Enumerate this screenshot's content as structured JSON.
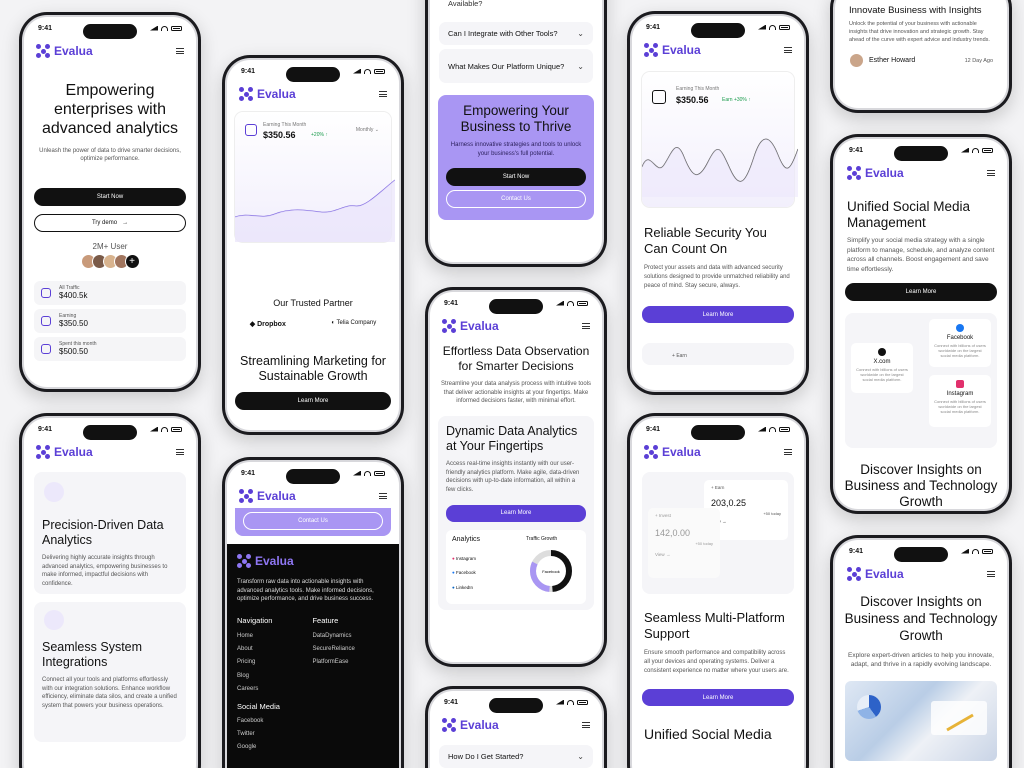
{
  "brand": {
    "name": "Evalua",
    "accent": "#5b3fd6",
    "status_time": "9:41"
  },
  "p1": {
    "headline": "Empowering enterprises with advanced analytics",
    "sub": "Unleash the power of data to drive smarter decisions, optimize performance.",
    "start_btn": "Start Now",
    "demo_btn": "Try demo",
    "users_label": "2M+ User",
    "stats": [
      {
        "label": "All Traffic",
        "value": "$400.5k"
      },
      {
        "label": "Earning",
        "value": "$350.50"
      },
      {
        "label": "Spent this month",
        "value": "$500.50"
      }
    ]
  },
  "p2": {
    "earning_label": "Earning This Month",
    "earning_value": "$350.56",
    "earning_delta": "+20% ↑",
    "period": "Monthly",
    "partner_title": "Our Trusted Partner",
    "partners": [
      "Dropbox",
      "Telia Company"
    ],
    "headline": "Streamlining Marketing for Sustainable Growth",
    "learn_btn": "Learn More"
  },
  "p3": {
    "faq_top": "Available?",
    "faqs": [
      "Can I Integrate with Other Tools?",
      "What Makes Our Platform Unique?"
    ],
    "headline": "Empowering Your Business to Thrive",
    "sub": "Harness innovative strategies and tools to unlock your business's full potential.",
    "start_btn": "Start Now",
    "contact_btn": "Contact Us"
  },
  "p4": {
    "earning_label": "Earning This Month",
    "earning_value": "$350.56",
    "earning_delta": "Earn +30% ↑",
    "headline": "Reliable Security You Can Count On",
    "sub": "Protect your assets and data with advanced security solutions designed to provide unmatched reliability and peace of mind. Stay secure, always.",
    "learn_btn": "Learn More",
    "foot": "Earn"
  },
  "p5": {
    "top_title": "Innovate Business with Insights",
    "top_sub": "Unlock the potential of your business with actionable insights that drive innovation and strategic growth. Stay ahead of the curve with expert advice and industry trends.",
    "author": "Esther Howard",
    "ago": "12 Day Ago"
  },
  "p6": {
    "headline": "Unified Social Media Management",
    "sub": "Simplify your social media strategy with a single platform to manage, schedule, and analyze content across all channels. Boost engagement and save time effortlessly.",
    "learn_btn": "Learn More",
    "nodes": [
      {
        "name": "Facebook",
        "desc": "Connect with billions of users worldwide on the largest social media platform."
      },
      {
        "name": "X.com",
        "desc": "Connect with billions of users worldwide on the largest social media platform."
      },
      {
        "name": "Instagram",
        "desc": "Connect with billions of users worldwide on the largest social media platform."
      }
    ],
    "bottom": "Discover Insights on Business and Technology Growth"
  },
  "p7": {
    "headline": "Precision-Driven Data Analytics",
    "sub": "Delivering highly accurate insights through advanced analytics, empowering businesses to make informed, impactful decisions with confidence.",
    "headline2": "Seamless System Integrations",
    "sub2": "Connect all your tools and platforms effortlessly with our integration solutions. Enhance workflow efficiency, eliminate data silos, and create a unified system that powers your business operations."
  },
  "p8": {
    "contact_btn": "Contact Us",
    "about": "Transform raw data into actionable insights with advanced analytics tools. Make informed decisions, optimize performance, and drive business success.",
    "nav_title": "Navigation",
    "nav": [
      "Home",
      "About",
      "Pricing",
      "Blog",
      "Careers"
    ],
    "feat_title": "Feature",
    "feat": [
      "DataDynamics",
      "SecureReliance",
      "PlatformEase"
    ],
    "social_title": "Social Media",
    "social": [
      "Facebook",
      "Twitter",
      "Google"
    ]
  },
  "p9": {
    "headline": "Effortless Data Observation for Smarter Decisions",
    "sub": "Streamline your data analysis process with intuitive tools that deliver actionable insights at your fingertips. Make informed decisions faster, with minimal effort.",
    "headline2": "Dynamic Data Analytics at Your Fingertips",
    "sub2": "Access real-time insights instantly with our user-friendly analytics platform. Make agile, data-driven decisions with up-to-date information, all within a few clicks.",
    "learn_btn": "Learn More",
    "analytics": "Analytics",
    "traffic": "Traffic Growth",
    "social": [
      "Instagram",
      "Facebook",
      "LinkedIn"
    ],
    "donut_label": "Facebook"
  },
  "p10": {
    "earn_label": "Earn",
    "earn_value": "203,0.25",
    "earn_delta": "+50 today",
    "invest_label": "Invest",
    "invest_value": "142,0.00",
    "invest_delta": "+50 today",
    "view": "View",
    "headline": "Seamless Multi-Platform Support",
    "sub": "Ensure smooth performance and compatibility across all your devices and operating systems. Deliver a consistent experience no matter where your users are.",
    "learn_btn": "Learn More",
    "bottom": "Unified Social Media"
  },
  "p11": {
    "faq": "How Do I Get Started?"
  },
  "p12": {
    "headline": "Discover Insights on Business and Technology Growth",
    "sub": "Explore expert-driven articles to help you innovate, adapt, and thrive in a rapidly evolving landscape."
  }
}
